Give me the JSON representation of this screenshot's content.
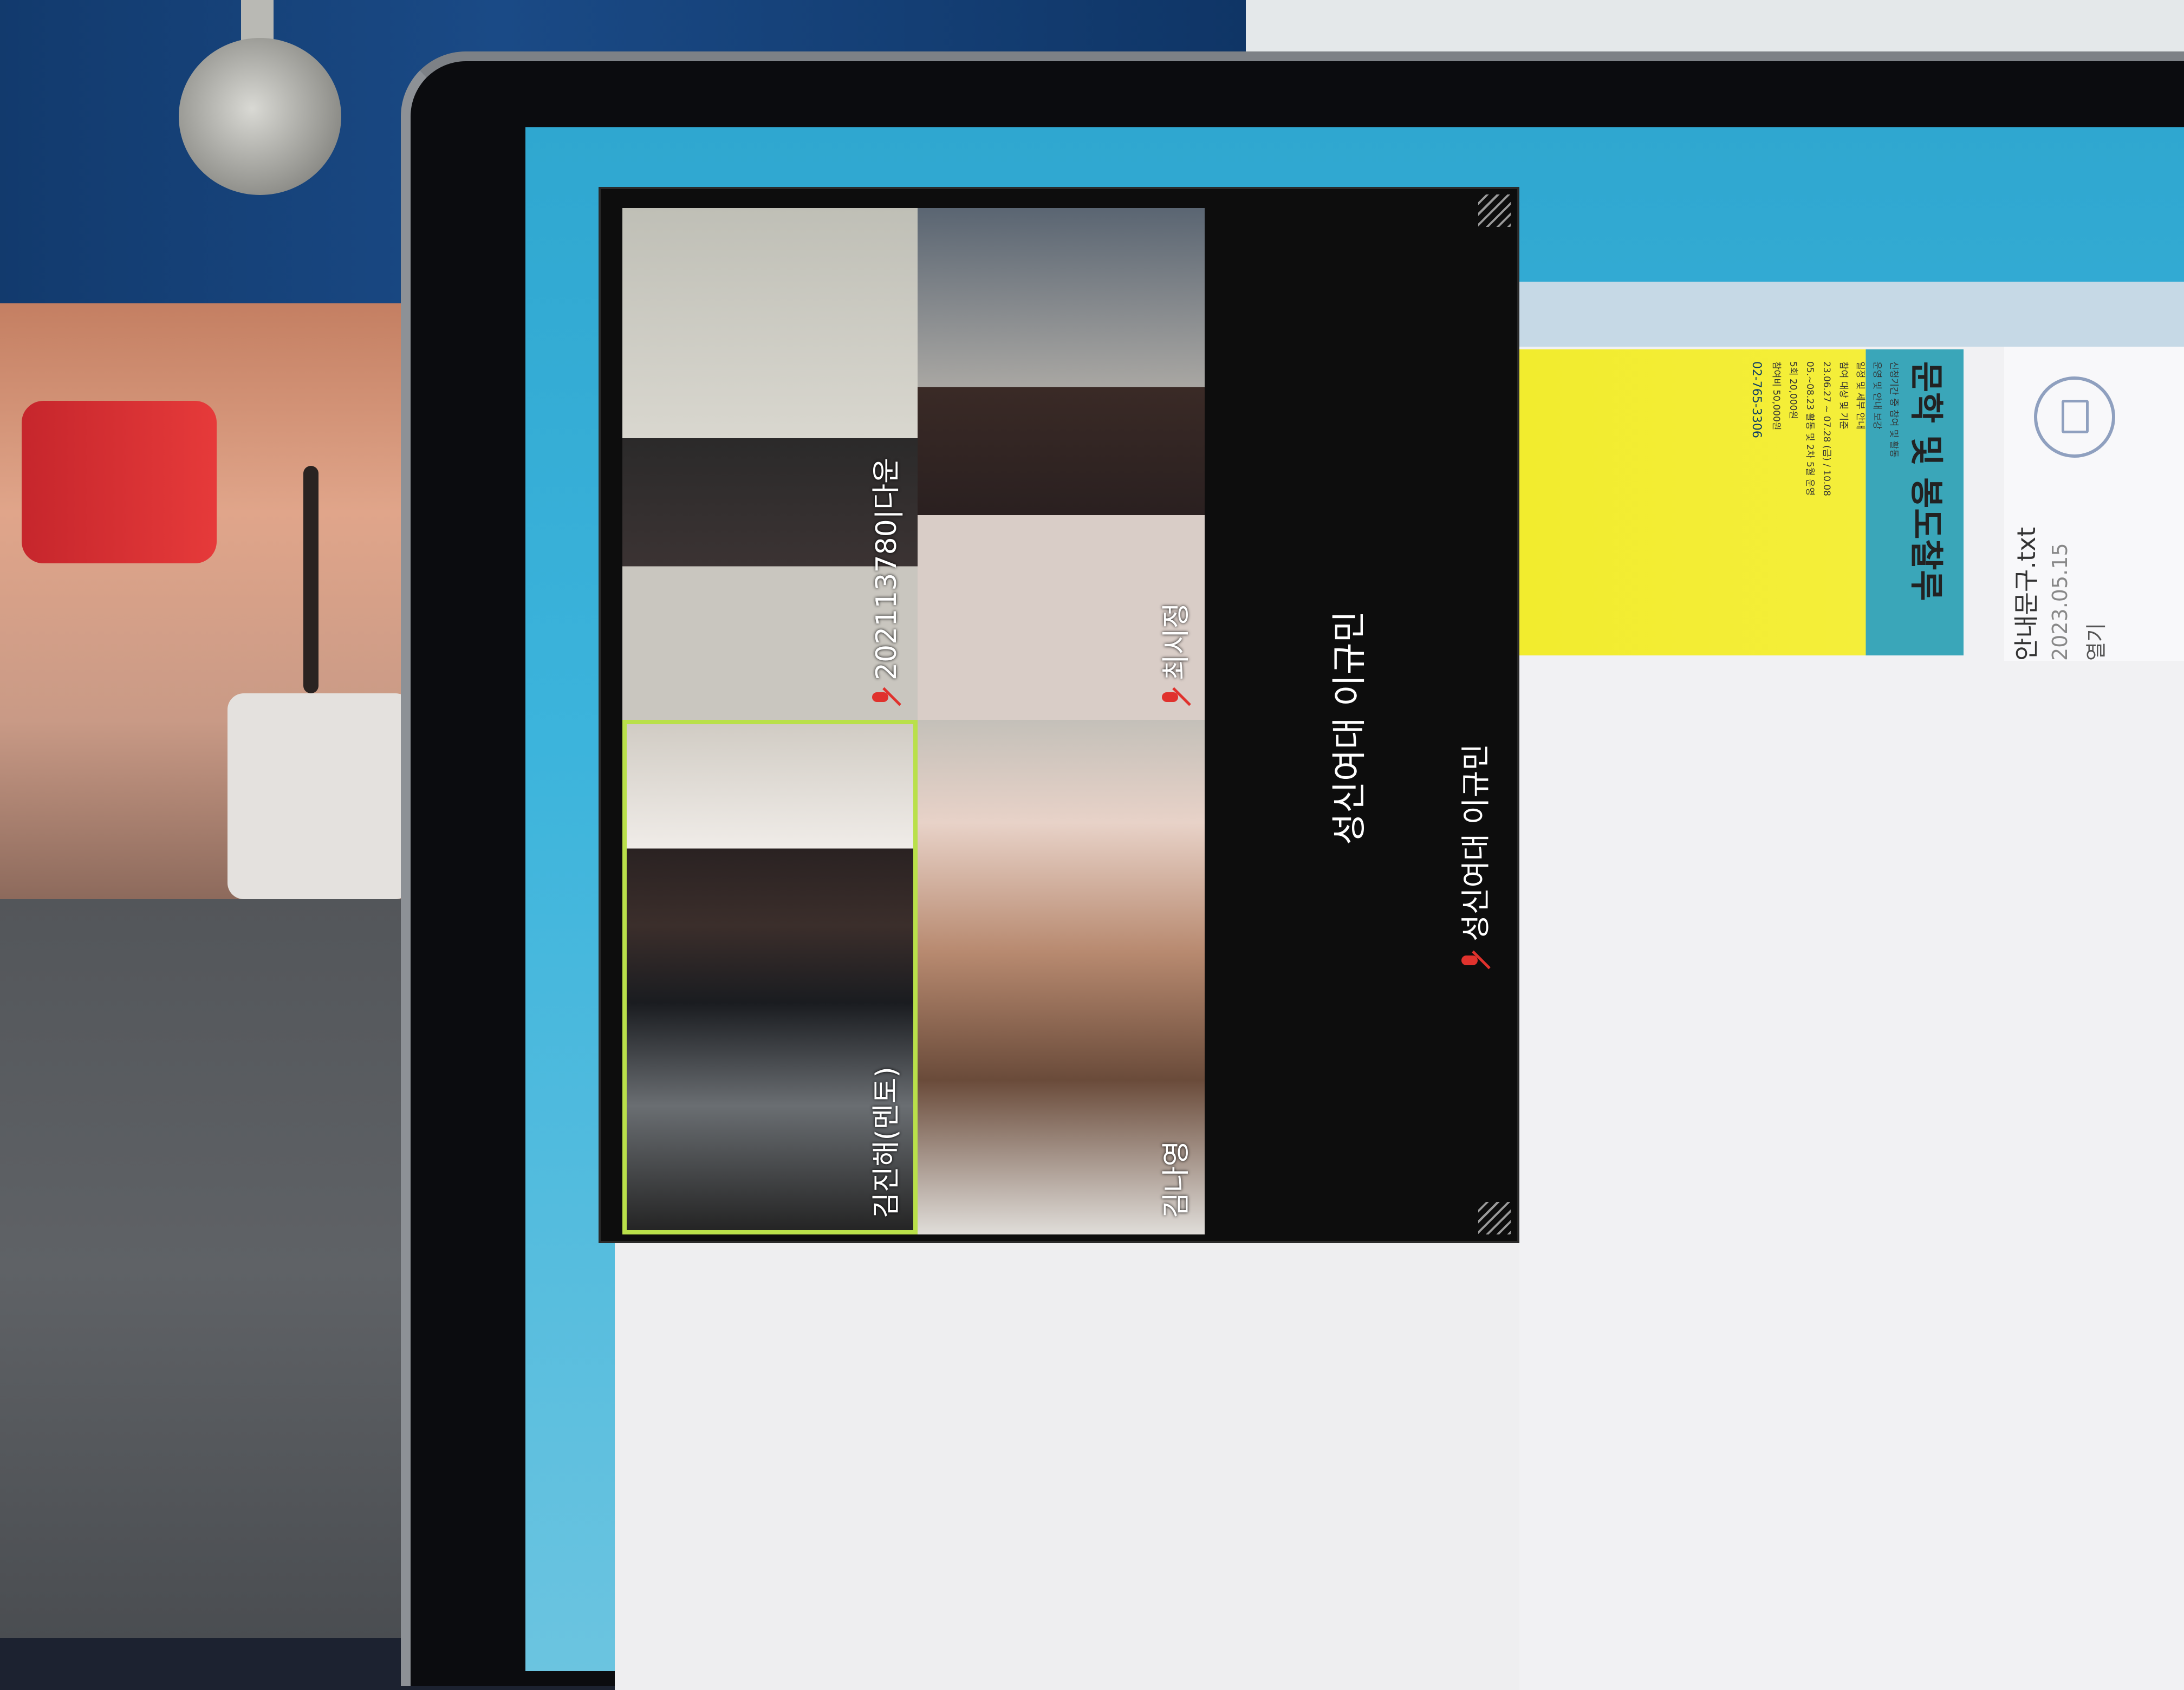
{
  "meeting": {
    "title": "",
    "main_speaker": "성신여대 이규민",
    "self_label": "성신여대 이규민",
    "participants": [
      {
        "name": "202113780|다운",
        "muted": true
      },
      {
        "name": "최시정",
        "muted": true
      },
      {
        "name": "김진해(멘토)",
        "muted": false,
        "active_speaker": true
      },
      {
        "name": "김나영",
        "muted": false
      }
    ]
  },
  "poster": {
    "title": "문학 및 봉도찰루",
    "lines": [
      "신청기간 중 참여 및 활동",
      "운영 및 안내 보강",
      "일정 및 세부 안내",
      "참여 대상 및 기준",
      "23.06.27 ~ 07.28 (금) / 10.08",
      "05.~08.23 활동 및 2차 5월 운영",
      "5회 20,000원",
      "참여비 50,000원"
    ],
    "contact": "02-765-3306"
  },
  "file": {
    "name": "안내문구.txt",
    "date": "2023.05.15",
    "action": "열기"
  },
  "colors": {
    "active_border": "#b9e04a",
    "mic_muted": "#e0322d",
    "desktop": "#3cb4dc"
  }
}
